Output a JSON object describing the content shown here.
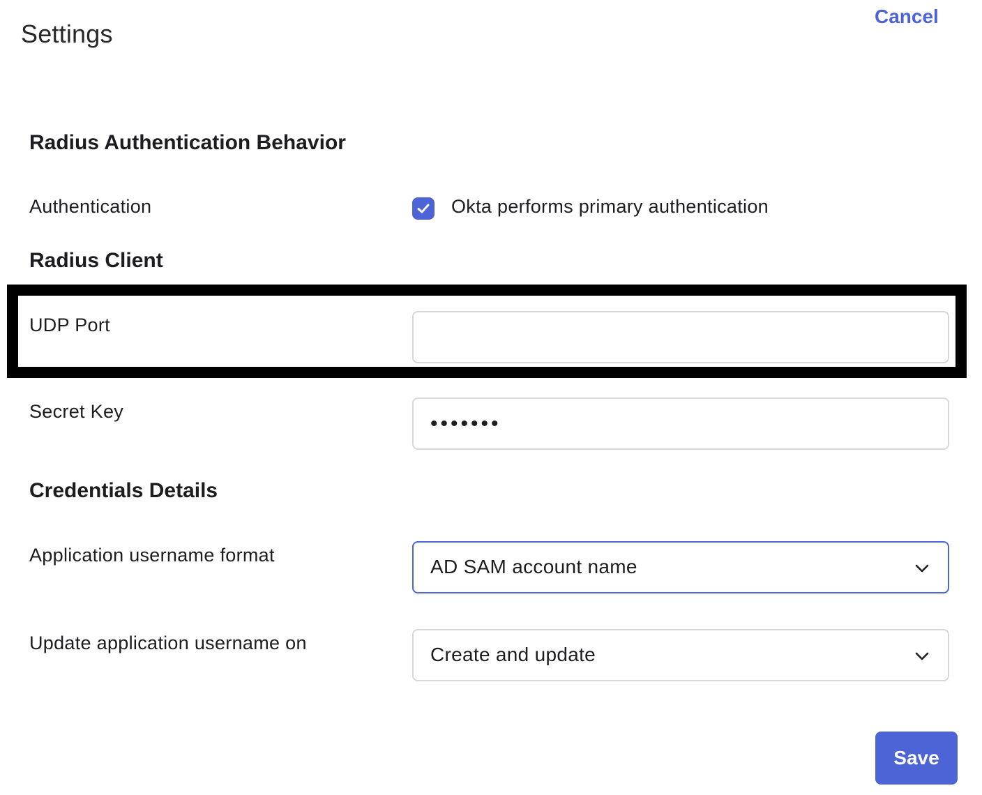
{
  "header": {
    "title": "Settings",
    "cancel_label": "Cancel"
  },
  "sections": {
    "radius_auth": {
      "heading": "Radius Authentication Behavior",
      "authentication_label": "Authentication",
      "authentication_checkbox_label": "Okta performs primary authentication",
      "authentication_checked": true
    },
    "radius_client": {
      "heading": "Radius Client",
      "udp_port_label": "UDP Port",
      "udp_port_value": "",
      "secret_key_label": "Secret Key",
      "secret_key_value": "•••••••"
    },
    "credentials": {
      "heading": "Credentials Details",
      "username_format_label": "Application username format",
      "username_format_value": "AD SAM account name",
      "update_on_label": "Update application username on",
      "update_on_value": "Create and update"
    }
  },
  "footer": {
    "save_label": "Save"
  },
  "icons": {
    "checkbox": "check-icon",
    "select": "chevron-down-icon"
  },
  "colors": {
    "accent": "#4c64d6",
    "highlight_border": "#000000"
  }
}
